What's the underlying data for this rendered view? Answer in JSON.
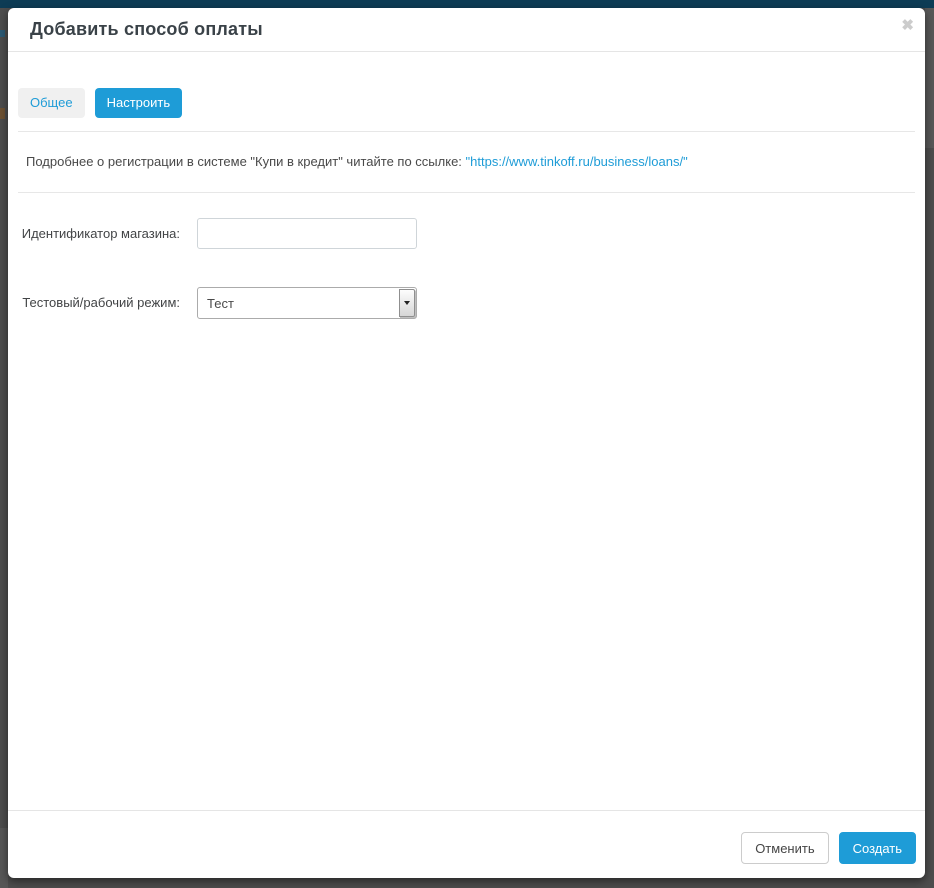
{
  "colors": {
    "accent_blue": "#1e9cd7",
    "top_bar": "#0d3c55",
    "backdrop": "#4d4d4d"
  },
  "modal": {
    "title": "Добавить способ оплаты",
    "close_icon": "✖",
    "tabs": [
      {
        "label": "Общее",
        "active": false
      },
      {
        "label": "Настроить",
        "active": true
      }
    ],
    "info": {
      "text": "Подробнее о регистрации в системе \"Купи в кредит\" читайте по ссылке: ",
      "link": "\"https://www.tinkoff.ru/business/loans/\""
    },
    "form": {
      "fields": [
        {
          "label": "Идентификатор магазина:",
          "type": "text",
          "value": ""
        },
        {
          "label": "Тестовый/рабочий режим:",
          "type": "select",
          "value": "Тест"
        }
      ]
    },
    "footer": {
      "cancel_label": "Отменить",
      "create_label": "Создать"
    }
  }
}
